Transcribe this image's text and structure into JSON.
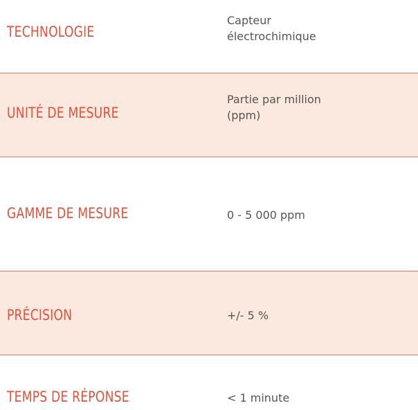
{
  "colors": {
    "accent": "#e0533a",
    "band": "#fbe8de",
    "border": "#e8775a",
    "text": "#555555"
  },
  "rows": [
    {
      "label": "TECHNOLOGIE",
      "value": "Capteur\nélectrochimique"
    },
    {
      "label": "UNITÉ DE MESURE",
      "value": "Partie par million\n(ppm)"
    },
    {
      "label": "GAMME DE MESURE",
      "value": "0 - 5 000 ppm"
    },
    {
      "label": "PRÉCISION",
      "value": "+/- 5 %"
    },
    {
      "label": "TEMPS DE RÉPONSE",
      "value": "< 1 minute"
    }
  ]
}
